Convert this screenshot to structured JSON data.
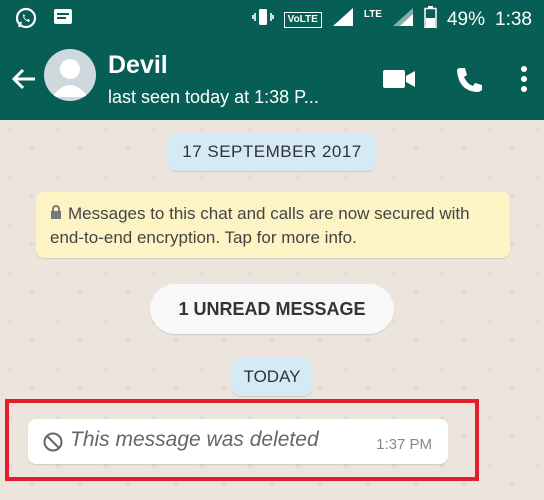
{
  "statusbar": {
    "battery": "49%",
    "time": "1:38",
    "network": "VoLTE",
    "lte": "LTE"
  },
  "header": {
    "title": "Devil",
    "subtitle": "last seen today at 1:38 P..."
  },
  "chat": {
    "date_label": "17 SEPTEMBER 2017",
    "encryption_notice": "Messages to this chat and calls are now secured with end-to-end encryption. Tap for more info.",
    "unread_label": "1 UNREAD MESSAGE",
    "today_label": "TODAY",
    "message": {
      "text": "This message was deleted",
      "time": "1:37 PM"
    }
  },
  "colors": {
    "appbar": "#075e54",
    "highlight": "#e41e2c",
    "date_pill": "#d4eaf4",
    "encryption_pill": "#fcf4c4"
  },
  "icons": [
    "whatsapp-icon",
    "message-icon",
    "vibrate-icon",
    "signal-icon",
    "battery-icon",
    "back-arrow-icon",
    "avatar-icon",
    "video-call-icon",
    "phone-icon",
    "more-vert-icon",
    "lock-icon",
    "deleted-ban-icon"
  ]
}
